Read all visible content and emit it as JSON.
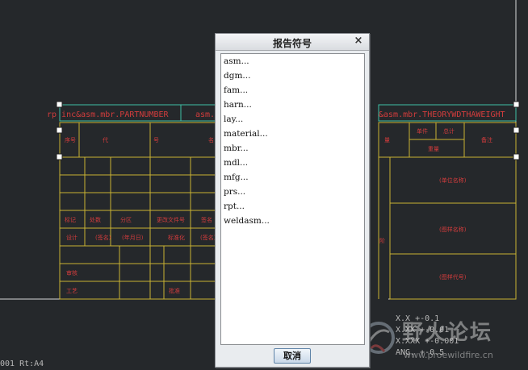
{
  "dialog": {
    "title": "报告符号",
    "close_glyph": "×",
    "items": [
      "asm...",
      "dgm...",
      "fam...",
      "harn...",
      "lay...",
      "material...",
      "mbr...",
      "mdl...",
      "mfg...",
      "prs...",
      "rpt...",
      "weldasm..."
    ],
    "cancel_label": "取消"
  },
  "drawing": {
    "param_left": "rp inc&asm.mbr.PARTNUMBER",
    "param_mid": "asm.",
    "param_right": "&asm.mbr.THEORYWDTHAWEIGHT",
    "header_xuhao": "序号",
    "header_daihao_a": "代",
    "header_daihao_b": "号",
    "header_ming": "名",
    "header_liang": "量",
    "header_danjian": "单件",
    "header_zongji": "总计",
    "header_zhongliang": "重量",
    "header_beizhu": "备注",
    "rev_biaoji": "标记",
    "rev_chushu": "处数",
    "rev_fenqu": "分区",
    "rev_wenjian": "更改文件号",
    "rev_qianming": "签名",
    "sig_sheji": "设计",
    "sig_qianming1": "(签名)",
    "sig_date": "(年月日)",
    "sig_biaozhunhua": "标准化",
    "sig_qianming2": "(签名)",
    "sig_shenhe": "审核",
    "sig_gongyi": "工艺",
    "sig_pizhun": "批准",
    "unit_name": "(单位名称)",
    "drawing_name": "(图样名称)",
    "drawing_code": "(图样代号)",
    "side_char": "阶",
    "tol1": "X.X    +-0.1",
    "tol2": "X.XX   +-0.01",
    "tol3": "X.XXX  +-0.001",
    "tol4": "ANG.   +-0.5",
    "bottom_left": "001   Rt:A4"
  },
  "watermark": {
    "title": "野火论坛",
    "url": "www.proewildfire.cn"
  },
  "colors": {
    "background": "#25282b",
    "line_yellow": "#c9b233",
    "text_red": "#d23c3c",
    "param_cyan": "#3fc1a6",
    "handle": "#ffffff"
  }
}
